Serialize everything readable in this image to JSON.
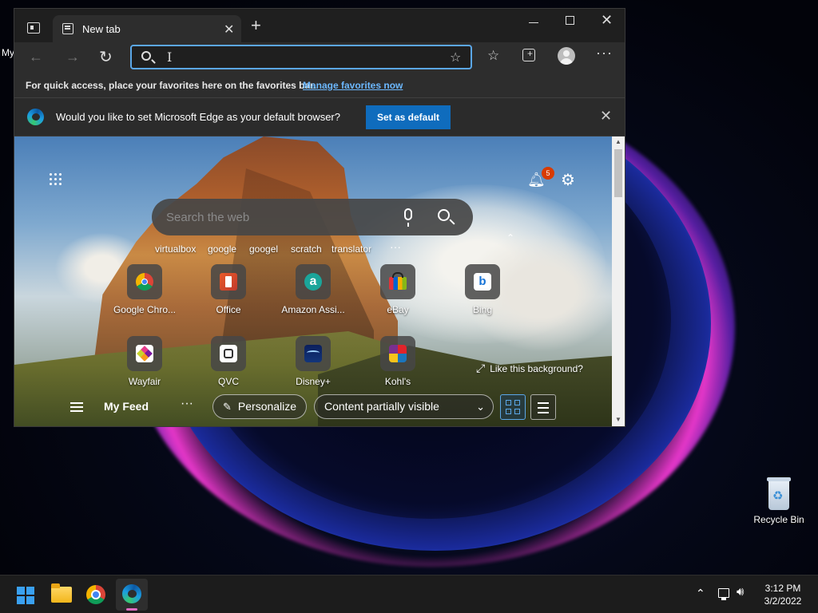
{
  "desktop": {
    "partial_label": "My",
    "recycle_bin_label": "Recycle Bin"
  },
  "browser": {
    "tab_title": "New tab",
    "address_value": "",
    "favorites_bar": {
      "message": "For quick access, place your favorites here on the favorites bar.",
      "link": "Manage favorites now"
    },
    "infobar": {
      "message": "Would you like to set Microsoft Edge as your default browser?",
      "button": "Set as default"
    },
    "accent_color": "#5ba7e8"
  },
  "newtab": {
    "notifications_count": "5",
    "search_placeholder": "Search the web",
    "quick_chips": [
      "virtualbox",
      "google",
      "googel",
      "scratch",
      "translator"
    ],
    "tiles_row1": [
      "Google Chro...",
      "Office",
      "Amazon Assi...",
      "eBay",
      "Bing"
    ],
    "tiles_row2": [
      "Wayfair",
      "QVC",
      "Disney+",
      "Kohl's"
    ],
    "like_background": "Like this background?",
    "feed": {
      "title": "My Feed",
      "personalize": "Personalize",
      "content_visibility": "Content partially visible"
    }
  },
  "taskbar": {
    "time": "3:12 PM",
    "date": "3/2/2022"
  }
}
